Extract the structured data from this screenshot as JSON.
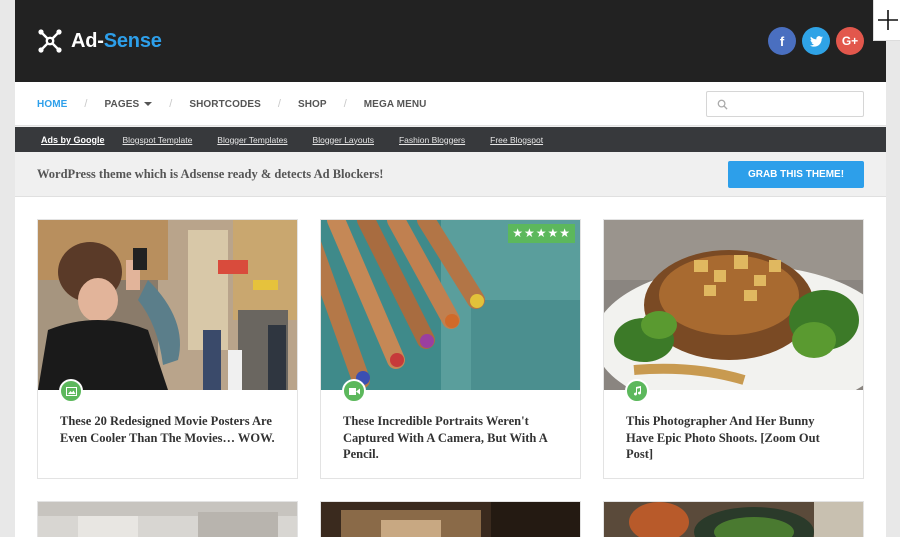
{
  "brand": {
    "name_main": "Ad-",
    "name_accent": "Sense",
    "accent_color": "#2d9fea"
  },
  "socials": [
    {
      "name": "facebook",
      "glyph": "f",
      "color": "#4a6fc0"
    },
    {
      "name": "twitter",
      "glyph": "t",
      "color": "#2fa3e6"
    },
    {
      "name": "google-plus",
      "glyph": "G+",
      "color": "#e2574c"
    }
  ],
  "nav": {
    "items": [
      {
        "label": "HOME",
        "active": true
      },
      {
        "label": "PAGES",
        "dropdown": true
      },
      {
        "label": "SHORTCODES"
      },
      {
        "label": "SHOP"
      },
      {
        "label": "MEGA MENU"
      }
    ],
    "separator": "/",
    "search_placeholder": ""
  },
  "ad_links": [
    "Ads by Google",
    "Blogspot Template",
    "Blogger Templates",
    "Blogger Layouts",
    "Fashion Bloggers",
    "Free Blogspot"
  ],
  "promo": {
    "text": "WordPress theme which is Adsense ready & detects Ad Blockers!",
    "button": "GRAB THIS THEME!"
  },
  "posts": [
    {
      "title": "These 20 Redesigned Movie Posters Are Even Cooler Than The Movies… WOW.",
      "format_icon": "image-icon"
    },
    {
      "title": "These Incredible Portraits Weren't Captured With A Camera, But With A Pencil.",
      "format_icon": "video-icon",
      "rating": "★★★★★"
    },
    {
      "title": "This Photographer And Her Bunny Have Epic Photo Shoots. [Zoom Out Post]",
      "format_icon": "music-icon"
    }
  ]
}
